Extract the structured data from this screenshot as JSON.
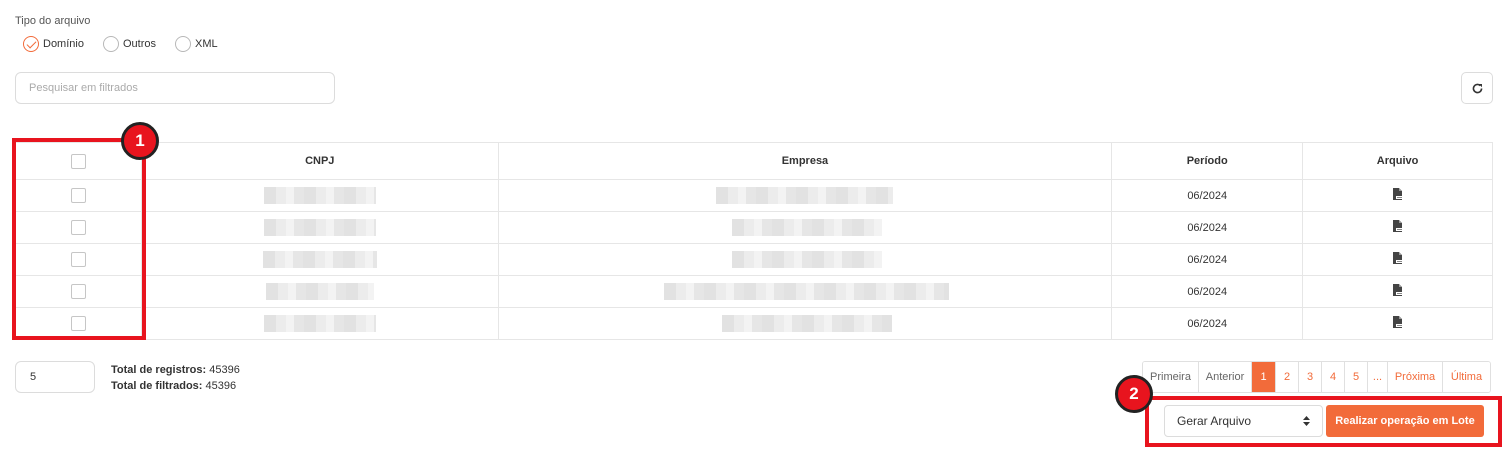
{
  "file_type": {
    "label": "Tipo do arquivo",
    "options": [
      {
        "label": "Domínio",
        "checked": true
      },
      {
        "label": "Outros",
        "checked": false
      },
      {
        "label": "XML",
        "checked": false
      }
    ]
  },
  "search": {
    "placeholder": "Pesquisar em filtrados",
    "value": ""
  },
  "refresh": {
    "icon": "refresh-icon"
  },
  "table": {
    "columns": [
      "CNPJ",
      "Empresa",
      "Período",
      "Arquivo"
    ],
    "rows": [
      {
        "cnpj": "",
        "empresa": "",
        "periodo": "06/2024",
        "arquivo_icon": "pdf-file-icon"
      },
      {
        "cnpj": "",
        "empresa": "",
        "periodo": "06/2024",
        "arquivo_icon": "pdf-file-icon"
      },
      {
        "cnpj": "",
        "empresa": "",
        "periodo": "06/2024",
        "arquivo_icon": "pdf-file-icon"
      },
      {
        "cnpj": "",
        "empresa": "",
        "periodo": "06/2024",
        "arquivo_icon": "pdf-file-icon"
      },
      {
        "cnpj": "",
        "empresa": "",
        "periodo": "06/2024",
        "arquivo_icon": "pdf-file-icon"
      }
    ]
  },
  "page_size": "5",
  "totals": {
    "registros_label": "Total de registros:",
    "registros_value": "45396",
    "filtrados_label": "Total de filtrados:",
    "filtrados_value": "45396"
  },
  "pagination": {
    "first": "Primeira",
    "previous": "Anterior",
    "pages": [
      "1",
      "2",
      "3",
      "4",
      "5"
    ],
    "active_page": "1",
    "ellipsis": "...",
    "next": "Próxima",
    "last": "Última"
  },
  "batch": {
    "select_value": "Gerar Arquivo",
    "button_label": "Realizar operação em Lote"
  },
  "annotations": {
    "badge_1": "1",
    "badge_2": "2"
  },
  "colors": {
    "accent": "#f26b3a",
    "annotation_red": "#e8141e"
  }
}
